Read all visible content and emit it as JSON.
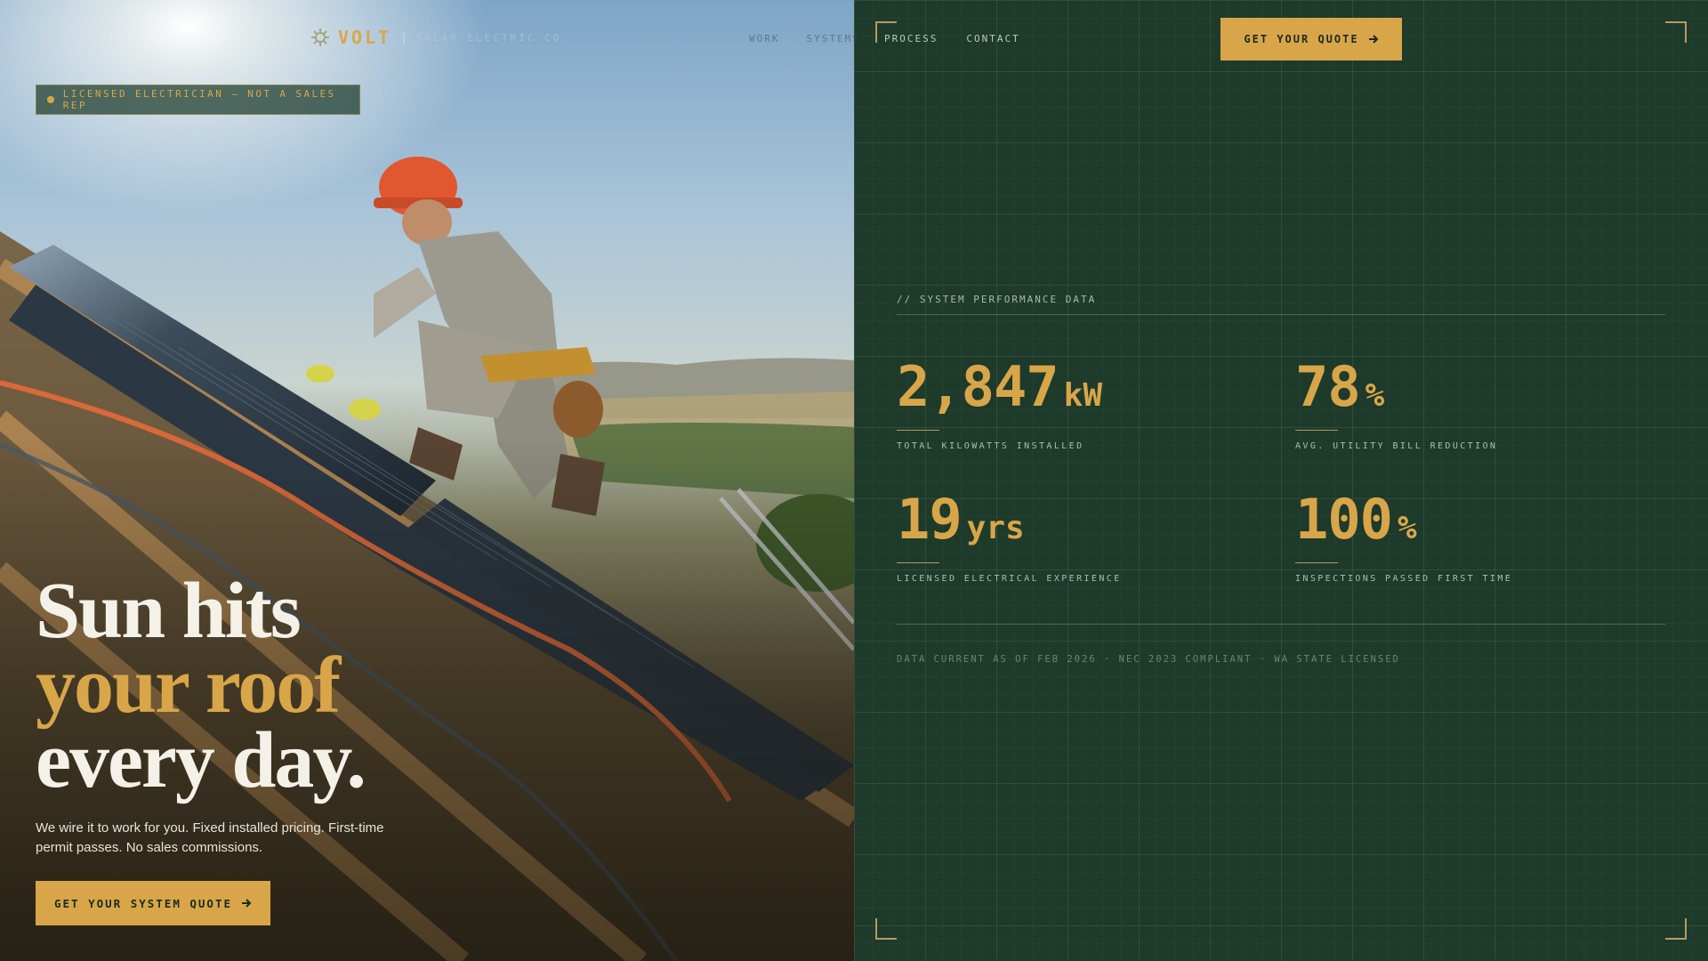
{
  "brand": {
    "name": "VOLT",
    "tagline": "SOLAR ELECTRIC CO"
  },
  "nav": {
    "items": [
      "WORK",
      "SYSTEMS",
      "PROCESS",
      "CONTACT"
    ],
    "cta_label": "GET YOUR QUOTE"
  },
  "hero": {
    "badge": "LICENSED ELECTRICIAN — NOT A SALES REP",
    "headline_line1": "Sun hits",
    "headline_line2": "your roof",
    "headline_line3": "every day.",
    "body": "We wire it to work for you. Fixed installed pricing. First-time permit passes. No sales commissions.",
    "cta_label": "GET YOUR SYSTEM QUOTE"
  },
  "stats": {
    "section_label": "// SYSTEM PERFORMANCE DATA",
    "items": [
      {
        "value": "2,847",
        "unit": "kW",
        "label": "TOTAL KILOWATTS INSTALLED"
      },
      {
        "value": "78",
        "unit": "%",
        "label": "AVG. UTILITY BILL REDUCTION"
      },
      {
        "value": "19",
        "unit": "yrs",
        "label": "LICENSED ELECTRICAL EXPERIENCE"
      },
      {
        "value": "100",
        "unit": "%",
        "label": "INSPECTIONS PASSED FIRST TIME"
      }
    ],
    "footnote": "DATA CURRENT AS OF FEB 2026 · NEC 2023 COMPLIANT · WA STATE LICENSED"
  },
  "colors": {
    "accent": "#d8a649",
    "panel_bg": "#1d3a2b",
    "headline_light": "#f4f1e8"
  },
  "icons": {
    "logo": "sun-gear-icon",
    "arrow": "arrow-right-icon"
  }
}
